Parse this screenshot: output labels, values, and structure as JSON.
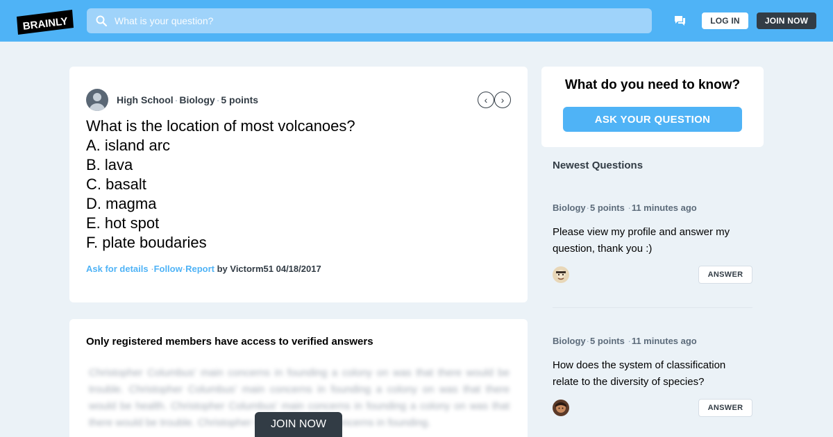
{
  "header": {
    "logo_text": "BRAINLY",
    "search_placeholder": "What is your question?",
    "login_label": "LOG IN",
    "join_label": "JOIN NOW"
  },
  "question": {
    "level": "High School",
    "subject": "Biology",
    "points": "5 points",
    "lines": [
      "What is the location of most volcanoes?",
      "A. island arc",
      "B. lava",
      "C. basalt",
      "D. magma",
      "E. hot spot",
      "F. plate boudaries"
    ],
    "ask_details": "Ask for details",
    "follow": "Follow",
    "report": "Report",
    "author_line": "by Victorm51 04/18/2017"
  },
  "answer_section": {
    "title": "Only registered members have access to verified answers",
    "blurred_text": "Christopher Columbus' main concerns in founding a colony on was that there would be trouble. Christopher Columbus' main concerns in founding a colony on was that there would be health. Christopher Columbus' main concerns in founding a colony on was that there would be trouble. Christopher Columbus' main concerns in founding.",
    "join_label": "JOIN NOW"
  },
  "sidebar": {
    "ask_title": "What do you need to know?",
    "ask_button": "ASK YOUR QUESTION",
    "newest_title": "Newest Questions",
    "items": [
      {
        "subject": "Biology",
        "points": "5 points",
        "time": "11 minutes ago",
        "text": "Please view my profile and answer my question, thank you :)",
        "answer_label": "ANSWER"
      },
      {
        "subject": "Biology",
        "points": "5 points",
        "time": "11 minutes ago",
        "text": "How does the system of classification relate to the diversity of species?",
        "answer_label": "ANSWER"
      }
    ]
  },
  "colors": {
    "brand_blue": "#4fb3f6",
    "dark": "#323c45",
    "background": "#ebf2f7"
  },
  "icons": [
    "search-icon",
    "chat-icon",
    "chevron-left-icon",
    "chevron-right-icon",
    "user-avatar"
  ]
}
